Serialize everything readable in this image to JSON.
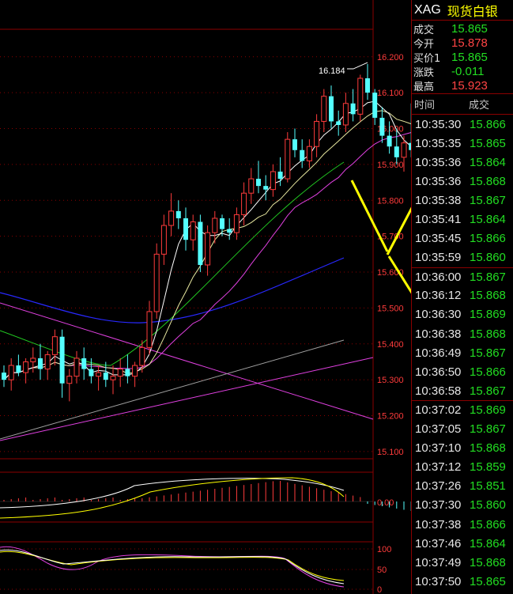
{
  "quote": {
    "symbol": "XAG",
    "name": "现货白银",
    "rows": [
      {
        "label": "成交",
        "value": "15.865",
        "color": "#22dd22"
      },
      {
        "label": "今开",
        "value": "15.878",
        "color": "#ff4444"
      },
      {
        "label": "买价1",
        "value": "15.865",
        "color": "#22dd22"
      },
      {
        "label": "涨跌",
        "value": "-0.011",
        "color": "#22dd22"
      },
      {
        "label": "最高",
        "value": "15.923",
        "color": "#ff4444"
      }
    ]
  },
  "ticks": {
    "header_time": "时间",
    "header_price": "成交",
    "rows": [
      {
        "time": "10:35:30",
        "price": "15.866"
      },
      {
        "time": "10:35:35",
        "price": "15.865"
      },
      {
        "time": "10:35:36",
        "price": "15.864"
      },
      {
        "time": "10:35:36",
        "price": "15.868"
      },
      {
        "time": "10:35:38",
        "price": "15.867"
      },
      {
        "time": "10:35:41",
        "price": "15.864"
      },
      {
        "time": "10:35:45",
        "price": "15.866"
      },
      {
        "time": "10:35:59",
        "price": "15.860"
      },
      {
        "time": "10:36:00",
        "price": "15.867"
      },
      {
        "time": "10:36:12",
        "price": "15.868"
      },
      {
        "time": "10:36:30",
        "price": "15.869"
      },
      {
        "time": "10:36:38",
        "price": "15.868"
      },
      {
        "time": "10:36:49",
        "price": "15.867"
      },
      {
        "time": "10:36:50",
        "price": "15.866"
      },
      {
        "time": "10:36:58",
        "price": "15.867"
      },
      {
        "time": "10:37:02",
        "price": "15.869"
      },
      {
        "time": "10:37:05",
        "price": "15.867"
      },
      {
        "time": "10:37:10",
        "price": "15.868"
      },
      {
        "time": "10:37:12",
        "price": "15.859"
      },
      {
        "time": "10:37:26",
        "price": "15.851"
      },
      {
        "time": "10:37:30",
        "price": "15.860"
      },
      {
        "time": "10:37:38",
        "price": "15.866"
      },
      {
        "time": "10:37:46",
        "price": "15.864"
      },
      {
        "time": "10:37:49",
        "price": "15.868"
      },
      {
        "time": "10:37:50",
        "price": "15.865"
      }
    ]
  },
  "chart_data": {
    "type": "candlestick",
    "ylim": [
      15.08,
      16.27
    ],
    "y_ticks": [
      "16.200",
      "16.100",
      "16.000",
      "15.900",
      "15.800",
      "15.700",
      "15.600",
      "15.500",
      "15.400",
      "15.300",
      "15.200",
      "15.100"
    ],
    "high_annotation": "16.184",
    "high_annotation_value": 16.184,
    "up_color": "#ff3b3b",
    "down_color": "#54ffff",
    "candles": [
      [
        15.32,
        15.34,
        15.28,
        15.3
      ],
      [
        15.3,
        15.36,
        15.27,
        15.34
      ],
      [
        15.34,
        15.37,
        15.31,
        15.32
      ],
      [
        15.32,
        15.36,
        15.29,
        15.35
      ],
      [
        15.35,
        15.39,
        15.32,
        15.36
      ],
      [
        15.36,
        15.4,
        15.3,
        15.33
      ],
      [
        15.33,
        15.38,
        15.3,
        15.37
      ],
      [
        15.37,
        15.44,
        15.34,
        15.42
      ],
      [
        15.42,
        15.44,
        15.25,
        15.29
      ],
      [
        15.29,
        15.33,
        15.24,
        15.31
      ],
      [
        15.31,
        15.38,
        15.29,
        15.36
      ],
      [
        15.36,
        15.39,
        15.3,
        15.33
      ],
      [
        15.33,
        15.36,
        15.29,
        15.31
      ],
      [
        15.31,
        15.34,
        15.27,
        15.32
      ],
      [
        15.32,
        15.35,
        15.28,
        15.3
      ],
      [
        15.3,
        15.34,
        15.26,
        15.31
      ],
      [
        15.31,
        15.36,
        15.28,
        15.33
      ],
      [
        15.33,
        15.37,
        15.29,
        15.31
      ],
      [
        15.31,
        15.35,
        15.28,
        15.34
      ],
      [
        15.34,
        15.41,
        15.32,
        15.39
      ],
      [
        15.39,
        15.52,
        15.37,
        15.49
      ],
      [
        15.49,
        15.68,
        15.47,
        15.65
      ],
      [
        15.65,
        15.76,
        15.62,
        15.73
      ],
      [
        15.73,
        15.82,
        15.7,
        15.77
      ],
      [
        15.77,
        15.8,
        15.72,
        15.75
      ],
      [
        15.75,
        15.78,
        15.66,
        15.69
      ],
      [
        15.69,
        15.76,
        15.66,
        15.74
      ],
      [
        15.74,
        15.76,
        15.6,
        15.62
      ],
      [
        15.62,
        15.73,
        15.59,
        15.71
      ],
      [
        15.71,
        15.77,
        15.68,
        15.75
      ],
      [
        15.75,
        15.76,
        15.7,
        15.72
      ],
      [
        15.72,
        15.75,
        15.69,
        15.71
      ],
      [
        15.71,
        15.78,
        15.69,
        15.76
      ],
      [
        15.76,
        15.85,
        15.73,
        15.82
      ],
      [
        15.82,
        15.89,
        15.79,
        15.86
      ],
      [
        15.86,
        15.91,
        15.82,
        15.84
      ],
      [
        15.84,
        15.87,
        15.8,
        15.83
      ],
      [
        15.83,
        15.9,
        15.81,
        15.88
      ],
      [
        15.88,
        15.92,
        15.84,
        15.86
      ],
      [
        15.86,
        15.99,
        15.85,
        15.97
      ],
      [
        15.97,
        16.0,
        15.92,
        15.94
      ],
      [
        15.94,
        15.97,
        15.89,
        15.91
      ],
      [
        15.91,
        15.97,
        15.89,
        15.95
      ],
      [
        15.95,
        16.04,
        15.92,
        16.02
      ],
      [
        16.02,
        16.11,
        15.99,
        16.09
      ],
      [
        16.09,
        16.12,
        16.0,
        16.02
      ],
      [
        16.02,
        16.05,
        15.98,
        16.01
      ],
      [
        16.01,
        16.1,
        15.99,
        16.07
      ],
      [
        16.07,
        16.11,
        16.02,
        16.04
      ],
      [
        16.04,
        16.15,
        16.02,
        16.14
      ],
      [
        16.14,
        16.18,
        16.08,
        16.1
      ],
      [
        16.1,
        16.11,
        16.01,
        16.03
      ],
      [
        16.03,
        16.06,
        15.96,
        15.98
      ],
      [
        15.98,
        16.02,
        15.93,
        15.95
      ],
      [
        15.95,
        16.0,
        15.9,
        15.92
      ],
      [
        15.92,
        15.98,
        15.88,
        15.96
      ],
      [
        15.96,
        16.07,
        15.92,
        15.94
      ],
      [
        15.94,
        15.97,
        15.87,
        15.88
      ],
      [
        15.88,
        15.93,
        15.84,
        15.87
      ],
      [
        15.87,
        15.89,
        15.83,
        15.86
      ]
    ],
    "macd_y_label": "0.00",
    "kdj_y_ticks": [
      "100",
      "50",
      "0"
    ]
  }
}
